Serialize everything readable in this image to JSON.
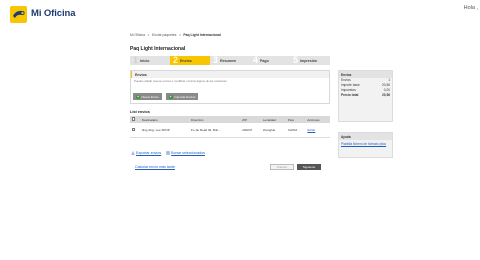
{
  "header": {
    "brand": "Mi Oficina",
    "greeting": "Hola ,",
    "brand_color": "#f7c600"
  },
  "breadcrumb": [
    "Mi Oficina",
    ">",
    "Enviar paquetes",
    ">",
    "Paq Light Internacional"
  ],
  "page_title": "Paq Light Internacional",
  "steps": [
    {
      "num": "1",
      "label": "Inicio",
      "state": "done"
    },
    {
      "num": "2",
      "label": "Envíos",
      "state": "active"
    },
    {
      "num": "3",
      "label": "Resumen",
      "state": "todo"
    },
    {
      "num": "4",
      "label": "Pago",
      "state": "todo"
    },
    {
      "num": "5",
      "label": "Impresión",
      "state": "todo"
    }
  ],
  "envios": {
    "title": "Envíos",
    "description": "Puedes añadir nuevos envíos ó modificar o borrar alguno de los existentes",
    "btn_nuevo": "Nuevo Envío",
    "btn_importar": "Importar Envíos"
  },
  "list": {
    "title": "List envíos",
    "headers": [
      "",
      "Destinatario",
      "Dirección",
      "ZIP",
      "Localidad",
      "País",
      "Acciones"
    ],
    "rows": [
      {
        "destinatario": "ding ding, Lee SPOP",
        "direccion": "Fu Jie Road 46, Buil...",
        "zip": "200237",
        "localidad": "shanghai",
        "pais": "CHINA",
        "accion": "Editar"
      }
    ]
  },
  "actions": {
    "exportar": "Exportar envíos",
    "borrar": "Borrar seleccionados",
    "calcular": "Calcular envío más tarde"
  },
  "nav": {
    "anterior": "Anterior",
    "siguiente": "Siguiente"
  },
  "summary": {
    "title": "Envíos",
    "rows": [
      {
        "label": "Envíos",
        "value": "1"
      },
      {
        "label": "Importe base",
        "value": "20,56"
      },
      {
        "label": "Impuestos",
        "value": "0,00"
      },
      {
        "label": "Precio total",
        "value": "20,56",
        "total": true
      }
    ]
  },
  "help": {
    "title": "Ayuda",
    "link": "Plantilla fichero de formato plico"
  }
}
